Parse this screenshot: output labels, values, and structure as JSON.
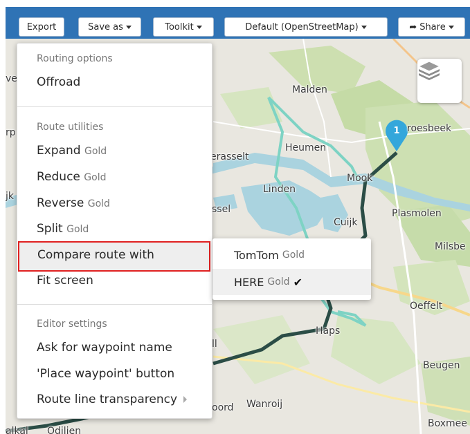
{
  "toolbar": {
    "export": "Export",
    "save_as": "Save as",
    "toolkit": "Toolkit",
    "map_style": "Default (OpenStreetMap)",
    "share": "Share"
  },
  "map": {
    "places": [
      "Malden",
      "Heumen",
      "erasselt",
      "Linden",
      "Mook",
      "Cuijk",
      "Plasmolen",
      "Milsbe",
      "Oeffelt",
      "Haps",
      "Beugen",
      "Wanroij",
      "oord",
      "Boxmee",
      "roesbeek",
      "ssel",
      "ve",
      "rp",
      "jk",
      "ll",
      "alkal",
      "Odilien"
    ],
    "marker_number": "1"
  },
  "menu": {
    "routing_options_header": "Routing options",
    "offroad": "Offroad",
    "route_utilities_header": "Route utilities",
    "expand": "Expand",
    "reduce": "Reduce",
    "reverse": "Reverse",
    "split": "Split",
    "gold": "Gold",
    "compare_route_with": "Compare route with",
    "fit_screen": "Fit screen",
    "editor_settings_header": "Editor settings",
    "ask_waypoint_name": "Ask for waypoint name",
    "place_waypoint_button": "'Place waypoint' button",
    "route_line_transparency": "Route line transparency"
  },
  "submenu": {
    "tomtom": "TomTom",
    "here": "HERE",
    "gold": "Gold",
    "check": "✔"
  }
}
